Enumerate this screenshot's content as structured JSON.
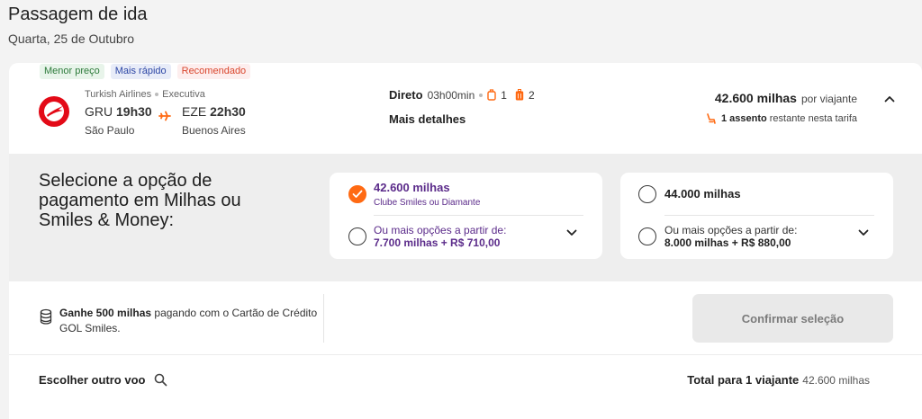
{
  "page": {
    "title": "Passagem de ida",
    "date": "Quarta, 25 de Outubro"
  },
  "badges": [
    "Menor preço",
    "Mais rápido",
    "Recomendado"
  ],
  "flight": {
    "airline": "Turkish Airlines",
    "cabin": "Executiva",
    "departure": {
      "code": "GRU",
      "time": "19h30",
      "city": "São Paulo"
    },
    "arrival": {
      "code": "EZE",
      "time": "22h30",
      "city": "Buenos Aires"
    },
    "stops": "Direto",
    "duration": "03h00min",
    "carry_on_count": "1",
    "checked_bag_count": "2",
    "more_details": "Mais detalhes"
  },
  "price": {
    "amount": "42.600 milhas",
    "per": "por viajante",
    "seats_bold": "1 assento",
    "seats_rest": "restante nesta tarifa"
  },
  "payment": {
    "title": "Selecione a opção de pagamento em Milhas ou Smiles & Money:",
    "option_a": {
      "main": "42.600 milhas",
      "sub": "Clube Smiles ou Diamante",
      "more_label": "Ou mais opções a partir de:",
      "more_value": "7.700 milhas + R$ 710,00"
    },
    "option_b": {
      "main": "44.000 milhas",
      "more_label": "Ou mais opções a partir de:",
      "more_value": "8.000 milhas + R$ 880,00"
    }
  },
  "promo": {
    "bold": "Ganhe 500 milhas",
    "rest": "pagando com o Cartão de Crédito GOL Smiles."
  },
  "confirm_label": "Confirmar seleção",
  "other_flight_label": "Escolher outro voo",
  "total": {
    "label": "Total para 1 viajante",
    "value": "42.600 milhas"
  },
  "colors": {
    "accent_orange": "#ff6a13",
    "purple": "#5b2b8a",
    "airline_red": "#e30a17"
  }
}
